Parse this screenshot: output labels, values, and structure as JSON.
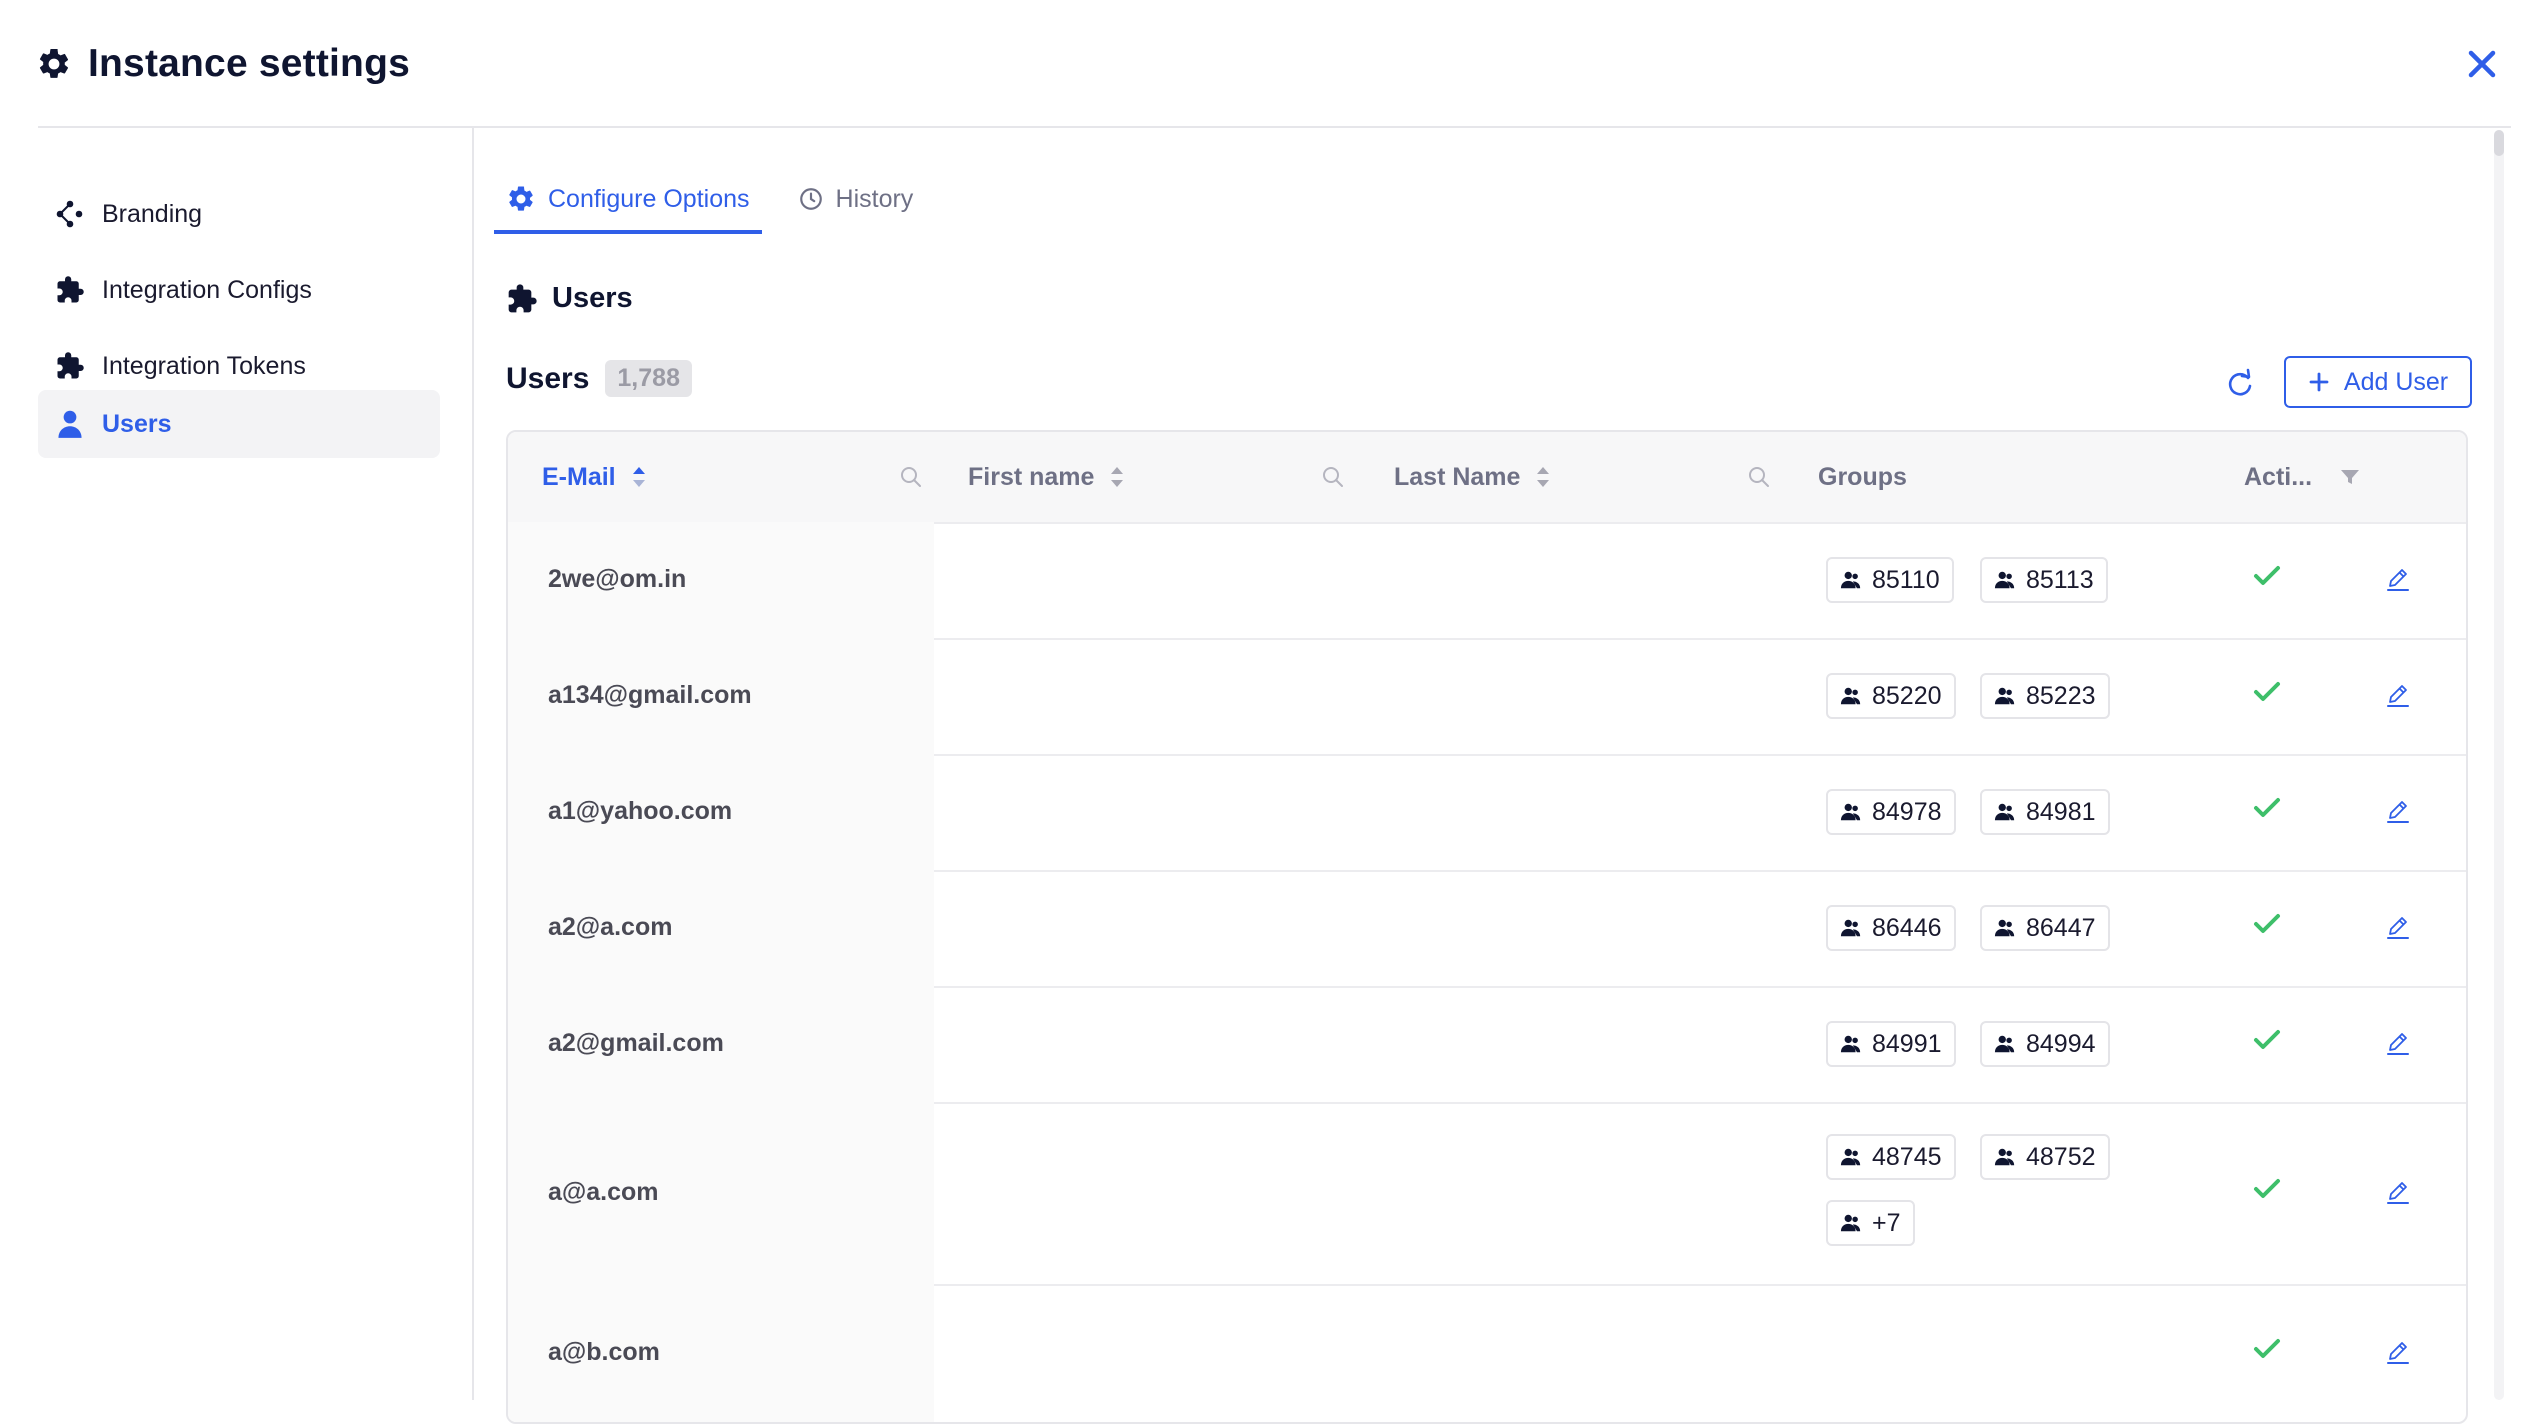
{
  "header": {
    "title": "Instance settings",
    "title_icon": "gear-icon",
    "close_icon": "close-icon"
  },
  "sidebar": {
    "items": [
      {
        "label": "Branding",
        "icon": "branding-icon",
        "active": false
      },
      {
        "label": "Integration Configs",
        "icon": "puzzle-icon",
        "active": false
      },
      {
        "label": "Integration Tokens",
        "icon": "puzzle-icon",
        "active": false
      },
      {
        "label": "Users",
        "icon": "user-icon",
        "active": true
      }
    ]
  },
  "tabs": [
    {
      "label": "Configure Options",
      "icon": "gear-icon",
      "active": true
    },
    {
      "label": "History",
      "icon": "clock-icon",
      "active": false
    }
  ],
  "section": {
    "title": "Users",
    "icon": "puzzle-icon"
  },
  "users_header": {
    "title": "Users",
    "count": "1,788",
    "add_label": "Add User"
  },
  "table": {
    "columns": {
      "email": "E-Mail",
      "first_name": "First name",
      "last_name": "Last Name",
      "groups": "Groups",
      "active": "Acti..."
    },
    "rows": [
      {
        "email": "2we@om.in",
        "groups": [
          "85110",
          "85113"
        ],
        "active": true
      },
      {
        "email": "a134@gmail.com",
        "groups": [
          "85220",
          "85223"
        ],
        "active": true
      },
      {
        "email": "a1@yahoo.com",
        "groups": [
          "84978",
          "84981"
        ],
        "active": true
      },
      {
        "email": "a2@a.com",
        "groups": [
          "86446",
          "86447"
        ],
        "active": true
      },
      {
        "email": "a2@gmail.com",
        "groups": [
          "84991",
          "84994"
        ],
        "active": true
      },
      {
        "email": "a@a.com",
        "groups": [
          "48745",
          "48752",
          "+7"
        ],
        "active": true
      },
      {
        "email": "a@b.com",
        "groups": [],
        "active": true
      }
    ]
  },
  "colors": {
    "accent": "#2f5ee8",
    "success": "#3ebf6a",
    "text": "#0f1530"
  }
}
